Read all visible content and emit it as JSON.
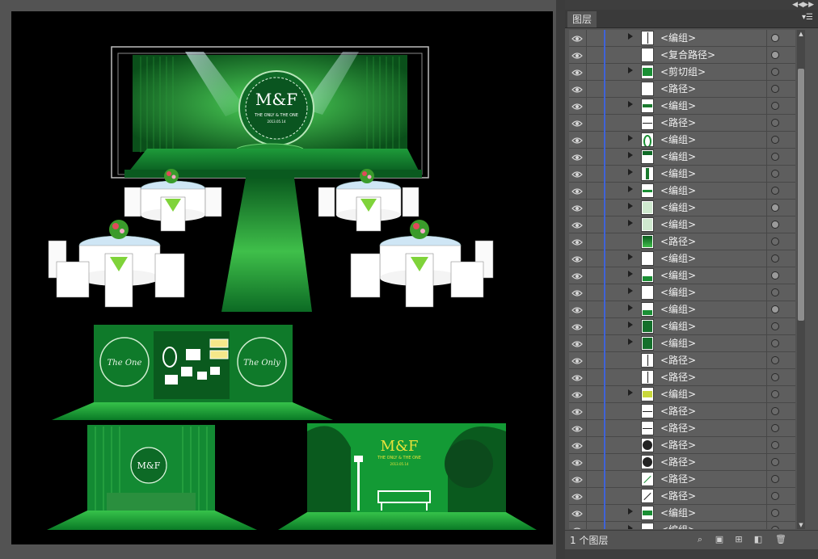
{
  "panel": {
    "tab_label": "图层",
    "footer_count": "1 个图层",
    "icons": {
      "collapse": "double-chevron-left-icon",
      "close": "double-chevron-right-icon",
      "menu": "panel-menu-icon",
      "locate": "search-icon",
      "clip": "make-clipping-mask-icon",
      "new_sublayer": "new-sublayer-icon",
      "new_layer": "new-layer-icon",
      "delete": "trash-icon"
    }
  },
  "layers": [
    {
      "name": "<编组>",
      "expand": true,
      "thumb": "vline",
      "target": "filled"
    },
    {
      "name": "<复合路径>",
      "expand": false,
      "thumb": "blank",
      "target": "filled"
    },
    {
      "name": "<剪切组>",
      "expand": true,
      "thumb": "green",
      "target": "empty"
    },
    {
      "name": "<路径>",
      "expand": false,
      "thumb": "blank",
      "target": "empty"
    },
    {
      "name": "<编组>",
      "expand": true,
      "thumb": "stripe",
      "target": "empty"
    },
    {
      "name": "<路径>",
      "expand": false,
      "thumb": "hline",
      "target": "empty"
    },
    {
      "name": "<编组>",
      "expand": true,
      "thumb": "ring",
      "target": "empty"
    },
    {
      "name": "<编组>",
      "expand": true,
      "thumb": "green-top",
      "target": "empty"
    },
    {
      "name": "<编组>",
      "expand": true,
      "thumb": "green-col",
      "target": "empty"
    },
    {
      "name": "<编组>",
      "expand": true,
      "thumb": "band",
      "target": "empty"
    },
    {
      "name": "<编组>",
      "expand": true,
      "thumb": "pale",
      "target": "filled"
    },
    {
      "name": "<编组>",
      "expand": true,
      "thumb": "pale",
      "target": "filled"
    },
    {
      "name": "<路径>",
      "expand": false,
      "thumb": "gradient",
      "target": "empty"
    },
    {
      "name": "<编组>",
      "expand": true,
      "thumb": "blank",
      "target": "empty"
    },
    {
      "name": "<编组>",
      "expand": true,
      "thumb": "green-bottom",
      "target": "filled"
    },
    {
      "name": "<编组>",
      "expand": true,
      "thumb": "blank",
      "target": "empty"
    },
    {
      "name": "<编组>",
      "expand": true,
      "thumb": "green-bottom",
      "target": "filled"
    },
    {
      "name": "<编组>",
      "expand": true,
      "thumb": "forest",
      "target": "empty"
    },
    {
      "name": "<编组>",
      "expand": true,
      "thumb": "forest",
      "target": "empty"
    },
    {
      "name": "<路径>",
      "expand": false,
      "thumb": "vline",
      "target": "empty"
    },
    {
      "name": "<路径>",
      "expand": false,
      "thumb": "vline",
      "target": "empty"
    },
    {
      "name": "<编组>",
      "expand": true,
      "thumb": "yellow",
      "target": "empty"
    },
    {
      "name": "<路径>",
      "expand": false,
      "thumb": "hline",
      "target": "empty"
    },
    {
      "name": "<路径>",
      "expand": false,
      "thumb": "hline",
      "target": "empty"
    },
    {
      "name": "<路径>",
      "expand": false,
      "thumb": "circle",
      "target": "empty"
    },
    {
      "name": "<路径>",
      "expand": false,
      "thumb": "circle",
      "target": "empty"
    },
    {
      "name": "<路径>",
      "expand": false,
      "thumb": "diag-green",
      "target": "empty"
    },
    {
      "name": "<路径>",
      "expand": false,
      "thumb": "diag",
      "target": "empty"
    },
    {
      "name": "<编组>",
      "expand": true,
      "thumb": "green-band",
      "target": "empty"
    },
    {
      "name": "<编组>",
      "expand": true,
      "thumb": "blank",
      "target": "empty"
    }
  ],
  "artwork": {
    "monogram": "M&F",
    "tagline": "THE ONLY & THE ONE",
    "date": "2013.05.14",
    "left_script": "The One",
    "right_script": "The Only"
  },
  "colors": {
    "layer_color": "#3f63d8",
    "green_dark": "#07461a",
    "green_mid": "#1a8f34",
    "green_light": "#7ee04a",
    "accent_yellow": "#e8e23a"
  }
}
